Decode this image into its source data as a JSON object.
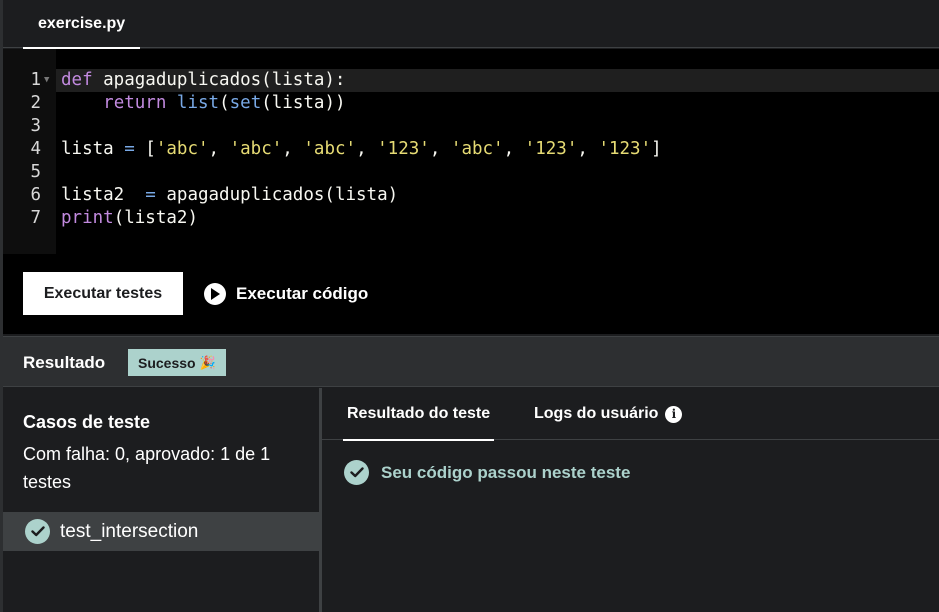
{
  "tab": {
    "label": "exercise.py"
  },
  "editor": {
    "lines": [
      {
        "num": "1",
        "parts": [
          {
            "t": "def",
            "c": "kw"
          },
          {
            "t": " apagaduplicados(lista):",
            "c": ""
          }
        ]
      },
      {
        "num": "2",
        "parts": [
          {
            "t": "    ",
            "c": ""
          },
          {
            "t": "return",
            "c": "kw"
          },
          {
            "t": " ",
            "c": ""
          },
          {
            "t": "list",
            "c": "bi"
          },
          {
            "t": "(",
            "c": ""
          },
          {
            "t": "set",
            "c": "bi"
          },
          {
            "t": "(lista))",
            "c": ""
          }
        ]
      },
      {
        "num": "3",
        "parts": []
      },
      {
        "num": "4",
        "parts": [
          {
            "t": "lista ",
            "c": ""
          },
          {
            "t": "=",
            "c": "op"
          },
          {
            "t": " [",
            "c": ""
          },
          {
            "t": "'abc'",
            "c": "str"
          },
          {
            "t": ", ",
            "c": ""
          },
          {
            "t": "'abc'",
            "c": "str"
          },
          {
            "t": ", ",
            "c": ""
          },
          {
            "t": "'abc'",
            "c": "str"
          },
          {
            "t": ", ",
            "c": ""
          },
          {
            "t": "'123'",
            "c": "str"
          },
          {
            "t": ", ",
            "c": ""
          },
          {
            "t": "'abc'",
            "c": "str"
          },
          {
            "t": ", ",
            "c": ""
          },
          {
            "t": "'123'",
            "c": "str"
          },
          {
            "t": ", ",
            "c": ""
          },
          {
            "t": "'123'",
            "c": "str"
          },
          {
            "t": "]",
            "c": ""
          }
        ]
      },
      {
        "num": "5",
        "parts": []
      },
      {
        "num": "6",
        "parts": [
          {
            "t": "lista2  ",
            "c": ""
          },
          {
            "t": "=",
            "c": "op"
          },
          {
            "t": " apagaduplicados(lista)",
            "c": ""
          }
        ]
      },
      {
        "num": "7",
        "parts": [
          {
            "t": "print",
            "c": "kw"
          },
          {
            "t": "(lista2)",
            "c": ""
          }
        ]
      }
    ]
  },
  "actions": {
    "run_tests_label": "Executar testes",
    "run_code_label": "Executar código"
  },
  "result": {
    "title": "Resultado",
    "badge": "Sucesso",
    "badge_icon": "🎉"
  },
  "cases": {
    "title": "Casos de teste",
    "summary": "Com falha: 0, aprovado: 1 de 1 testes",
    "items": [
      {
        "name": "test_intersection",
        "status": "passed"
      }
    ]
  },
  "output": {
    "tabs": [
      {
        "label": "Resultado do teste",
        "active": true
      },
      {
        "label": "Logs do usuário",
        "active": false
      }
    ],
    "pass_message": "Seu código passou neste teste"
  },
  "colors": {
    "accent": "#acd2cc",
    "editor_bg": "#000000",
    "panel_bg": "#1c1d1f",
    "bar_bg": "#2d2f31"
  }
}
